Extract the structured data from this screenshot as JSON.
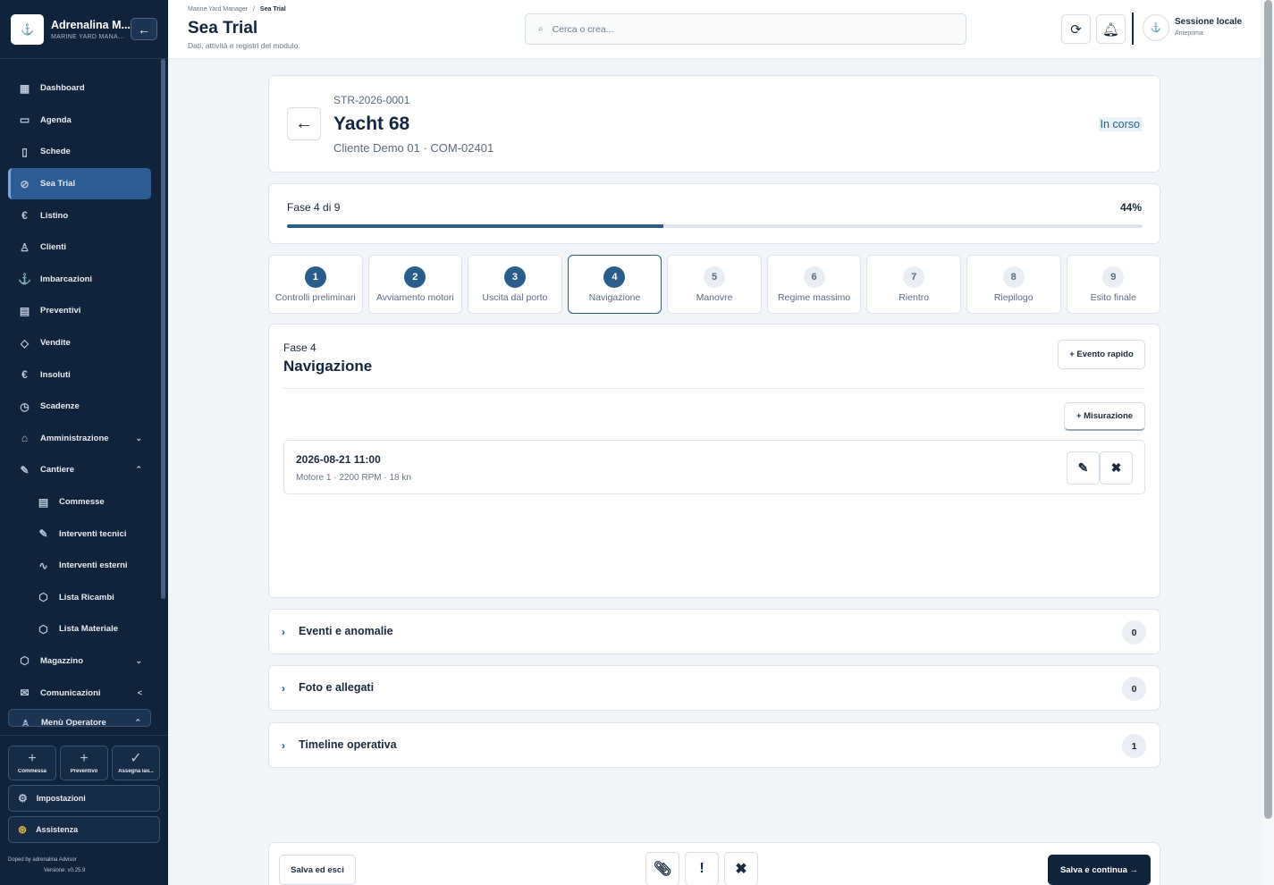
{
  "sidebar": {
    "brand_title": "Adrenalina M...",
    "brand_sub": "MARINE YARD MANA...",
    "collapse_icon": "←",
    "items": [
      {
        "label": "Dashboard",
        "icon": "▦"
      },
      {
        "label": "Agenda",
        "icon": "▭"
      },
      {
        "label": "Schede",
        "icon": "▯"
      },
      {
        "label": "Sea Trial",
        "icon": "⊘"
      },
      {
        "label": "Listino",
        "icon": "€"
      },
      {
        "label": "Clienti",
        "icon": "♙"
      },
      {
        "label": "Imbarcazioni",
        "icon": "⚓"
      },
      {
        "label": "Preventivi",
        "icon": "▤"
      },
      {
        "label": "Vendite",
        "icon": "◇"
      },
      {
        "label": "Insoluti",
        "icon": "€"
      },
      {
        "label": "Scadenze",
        "icon": "◷"
      },
      {
        "label": "Amministrazione",
        "icon": "⌂",
        "chev": "⌄"
      },
      {
        "label": "Cantiere",
        "icon": "✎",
        "chev": "⌃"
      }
    ],
    "subitems": [
      {
        "label": "Commesse",
        "icon": "▤"
      },
      {
        "label": "Interventi tecnici",
        "icon": "✎"
      },
      {
        "label": "Interventi esterni",
        "icon": "∿"
      },
      {
        "label": "Lista Ricambi",
        "icon": "⬡"
      },
      {
        "label": "Lista Materiale",
        "icon": "⬡"
      }
    ],
    "items2": [
      {
        "label": "Magazzino",
        "icon": "⬡",
        "chev": "⌄"
      },
      {
        "label": "Comunicazioni",
        "icon": "✉",
        "chev": "<"
      },
      {
        "label": "Menù Operatore",
        "icon": "♙",
        "chev": "⌃"
      }
    ],
    "quick": [
      {
        "label": "Commessa",
        "icon": "+"
      },
      {
        "label": "Preventivo",
        "icon": "+"
      },
      {
        "label": "Assegna lav...",
        "icon": "✓"
      }
    ],
    "settings_label": "Impostazioni",
    "help_label": "Assistenza",
    "footer_by": "Doped by adrenalina Advisor",
    "footer_version": "Versione: v0.25.9"
  },
  "topbar": {
    "crumb_root": "Marine Yard Manager",
    "crumb_sep": "/",
    "crumb_current": "Sea Trial",
    "title": "Sea Trial",
    "subtitle": "Dati, attività e registri del modulo.",
    "search_placeholder": "Cerca o crea...",
    "session_name": "Sessione locale",
    "session_role": "Anteprima"
  },
  "header": {
    "code": "STR-2026-0001",
    "title": "Yacht 68",
    "client": "Cliente Demo 01 · COM-02401",
    "status": "In corso"
  },
  "progress": {
    "label": "Fase 4 di 9",
    "percent_label": "44%",
    "fraction": 0.44
  },
  "steps": [
    {
      "num": "1",
      "label": "Controlli preliminari",
      "state": "done"
    },
    {
      "num": "2",
      "label": "Avviamento motori",
      "state": "done"
    },
    {
      "num": "3",
      "label": "Uscita dal porto",
      "state": "done"
    },
    {
      "num": "4",
      "label": "Navigazione",
      "state": "active"
    },
    {
      "num": "5",
      "label": "Manovre",
      "state": "todo"
    },
    {
      "num": "6",
      "label": "Regime massimo",
      "state": "todo"
    },
    {
      "num": "7",
      "label": "Rientro",
      "state": "todo"
    },
    {
      "num": "8",
      "label": "Riepilogo",
      "state": "todo"
    },
    {
      "num": "9",
      "label": "Esito finale",
      "state": "todo"
    }
  ],
  "phase": {
    "small": "Fase 4",
    "title": "Navigazione",
    "rapid_label": "+ Evento rapido",
    "measure_label": "+ Misurazione",
    "measurement": {
      "datetime": "2026-08-21 11:00",
      "details": "Motore 1 · 2200 RPM · 18 kn"
    }
  },
  "accordions": [
    {
      "title": "Eventi e anomalie",
      "count": "0"
    },
    {
      "title": "Foto e allegati",
      "count": "0"
    },
    {
      "title": "Timeline operativa",
      "count": "1"
    }
  ],
  "footer": {
    "save_exit": "Salva ed esci",
    "save_continue": "Salva e continua →"
  }
}
